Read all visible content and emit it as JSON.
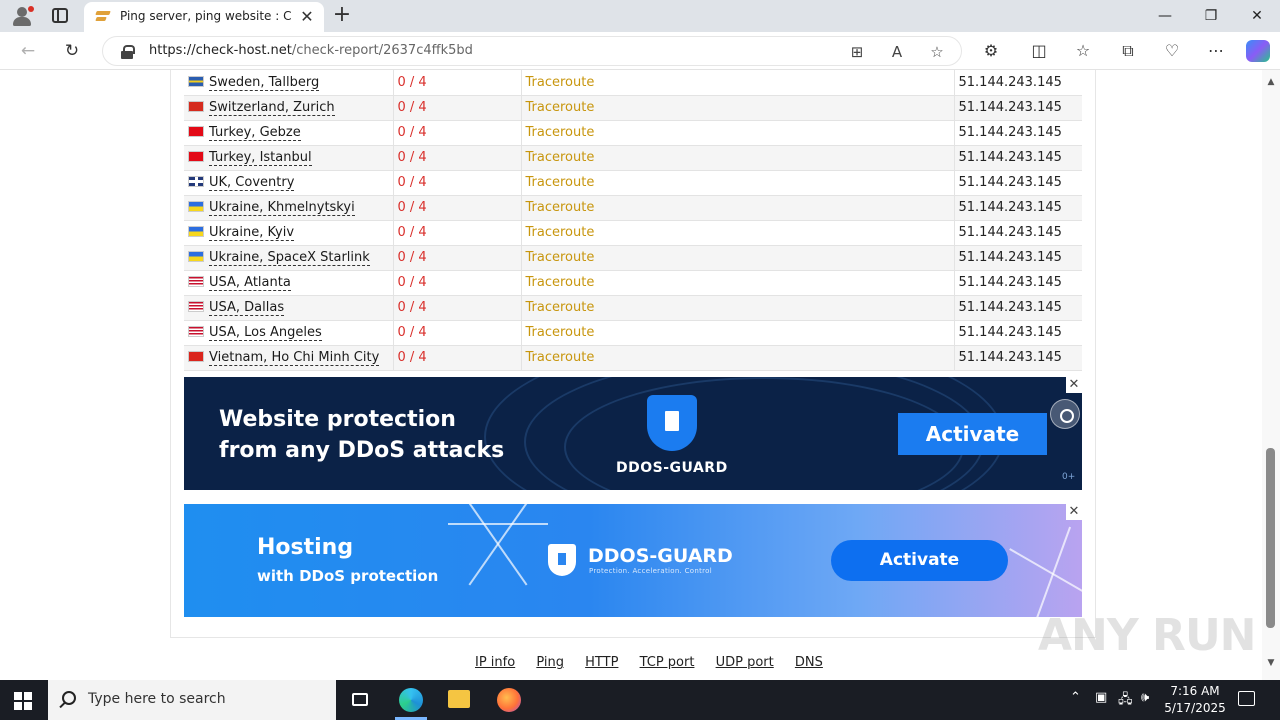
{
  "browser": {
    "tab_title": "Ping server, ping website : Check",
    "url_host": "https://check-host.net",
    "url_path": "/check-report/2637c4ffk5bd"
  },
  "results": [
    {
      "location": "Sweden, Tallberg",
      "flag": "se",
      "result": "0 / 4",
      "traceroute": "Traceroute",
      "ip": "51.144.243.145"
    },
    {
      "location": "Switzerland, Zurich",
      "flag": "ch",
      "result": "0 / 4",
      "traceroute": "Traceroute",
      "ip": "51.144.243.145"
    },
    {
      "location": "Turkey, Gebze",
      "flag": "tr",
      "result": "0 / 4",
      "traceroute": "Traceroute",
      "ip": "51.144.243.145"
    },
    {
      "location": "Turkey, Istanbul",
      "flag": "tr",
      "result": "0 / 4",
      "traceroute": "Traceroute",
      "ip": "51.144.243.145"
    },
    {
      "location": "UK, Coventry",
      "flag": "gb",
      "result": "0 / 4",
      "traceroute": "Traceroute",
      "ip": "51.144.243.145"
    },
    {
      "location": "Ukraine, Khmelnytskyi",
      "flag": "ua",
      "result": "0 / 4",
      "traceroute": "Traceroute",
      "ip": "51.144.243.145"
    },
    {
      "location": "Ukraine, Kyiv",
      "flag": "ua",
      "result": "0 / 4",
      "traceroute": "Traceroute",
      "ip": "51.144.243.145"
    },
    {
      "location": "Ukraine, SpaceX Starlink",
      "flag": "ua",
      "result": "0 / 4",
      "traceroute": "Traceroute",
      "ip": "51.144.243.145"
    },
    {
      "location": "USA, Atlanta",
      "flag": "us",
      "result": "0 / 4",
      "traceroute": "Traceroute",
      "ip": "51.144.243.145"
    },
    {
      "location": "USA, Dallas",
      "flag": "us",
      "result": "0 / 4",
      "traceroute": "Traceroute",
      "ip": "51.144.243.145"
    },
    {
      "location": "USA, Los Angeles",
      "flag": "us",
      "result": "0 / 4",
      "traceroute": "Traceroute",
      "ip": "51.144.243.145"
    },
    {
      "location": "Vietnam, Ho Chi Minh City",
      "flag": "vn",
      "result": "0 / 4",
      "traceroute": "Traceroute",
      "ip": "51.144.243.145"
    }
  ],
  "ad1": {
    "headline": "Website protection\nfrom any DDoS attacks",
    "brand": "DDOS-GUARD",
    "button": "Activate",
    "age_mark": "0+",
    "close": "✕"
  },
  "ad2": {
    "title": "Hosting",
    "subtitle": "with DDoS protection",
    "brand": "DDOS-GUARD",
    "tagline": "Protection. Acceleration. Control",
    "button": "Activate",
    "close": "✕"
  },
  "footer_links": [
    "IP info",
    "Ping",
    "HTTP",
    "TCP port",
    "UDP port",
    "DNS"
  ],
  "watermark": "ANY RUN",
  "taskbar": {
    "search_placeholder": "Type here to search",
    "time": "7:16 AM",
    "date": "5/17/2025"
  },
  "colors": {
    "result_fail": "#d9302c",
    "traceroute": "#c8960e",
    "ad1_bg": "#0b2247",
    "ad_accent": "#1b7cf0"
  }
}
